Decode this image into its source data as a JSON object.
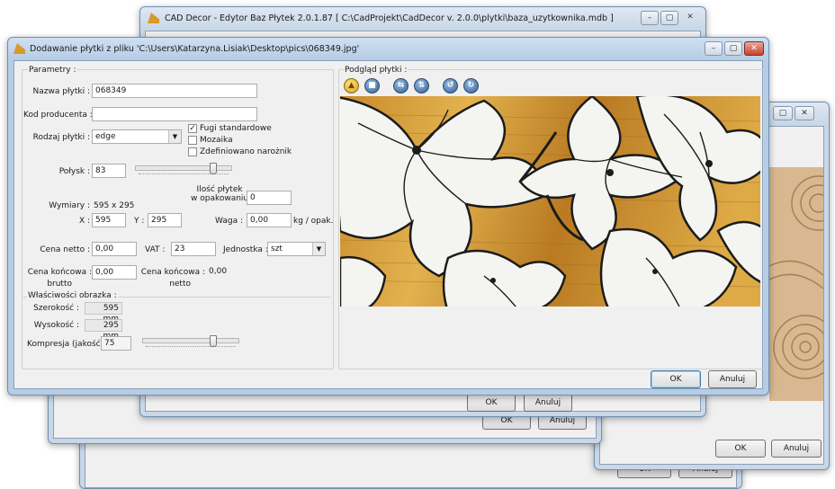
{
  "back_window_main": {
    "title": "CAD Decor - Edytor Baz Płytek 2.0.1.87 [ C:\\CadProjekt\\CadDecor v. 2.0.0\\plytki\\baza_uzytkownika.mdb ]",
    "ok_label": "OK",
    "cancel_label": "Anuluj"
  },
  "back_window_2": {
    "ok_label": "OK",
    "cancel_label": "Anuluj"
  },
  "back_window_3": {
    "ok_label": "OK",
    "cancel_label": "Anuluj"
  },
  "right_window": {
    "ok_label": "OK",
    "cancel_label": "Anuluj"
  },
  "dialog": {
    "title": "Dodawanie płytki z pliku 'C:\\Users\\Katarzyna.Lisiak\\Desktop\\pics\\068349.jpg'",
    "params_group": "Parametry :",
    "name_label": "Nazwa płytki :",
    "name_value": "068349",
    "producer_code_label": "Kod producenta :",
    "producer_code_value": "",
    "type_label": "Rodzaj płytki :",
    "type_value": "edge",
    "checkboxes": [
      {
        "label": "Fugi standardowe",
        "checked": true
      },
      {
        "label": "Mozaika",
        "checked": false
      },
      {
        "label": "Zdefiniowano narożnik",
        "checked": false
      }
    ],
    "gloss_label": "Połysk :",
    "gloss_value": "83",
    "gloss_level": 0.83,
    "pack_count_label_1": "Ilość płytek",
    "pack_count_label_2": "w opakowaniu",
    "pack_count_value": "0",
    "dims_label": "Wymiary :",
    "dims_value": "595 x 295",
    "x_label": "X :",
    "x_value": "595",
    "y_label": "Y :",
    "y_value": "295",
    "weight_label": "Waga :",
    "weight_value": "0,00",
    "weight_unit": "kg / opak.",
    "net_price_label": "Cena netto :",
    "net_price_value": "0,00",
    "vat_label": "VAT :",
    "vat_value": "23",
    "unit_label": "Jednostka :",
    "unit_value": "szt",
    "gross_final_label_1": "Cena końcowa :",
    "gross_final_label_2": "brutto",
    "gross_final_value": "0,00",
    "net_final_label_1": "Cena końcowa :",
    "net_final_label_2": "netto",
    "net_final_value": "0,00",
    "image_props_group": "Właściwości obrazka :",
    "width_label": "Szerokość :",
    "width_value": "595 mm",
    "height_label": "Wysokość :",
    "height_value": "295 mm",
    "compression_label": "Kompresja (jakość) :",
    "compression_value": "75",
    "compression_level": 0.75,
    "preview_group": "Podgląd płytki :",
    "toolbar_icons": [
      "open-folder-icon",
      "save-disk-icon",
      "flip-horizontal-icon",
      "flip-vertical-icon",
      "rotate-left-icon",
      "rotate-right-icon"
    ],
    "ok_label": "OK",
    "cancel_label": "Anuluj"
  },
  "colors": {
    "wood_light": "#d9a441",
    "wood_dark": "#8a5a1c",
    "petal": "#f4f4f0",
    "ink": "#1b1b1b",
    "beige_tile": "#d8b890"
  }
}
